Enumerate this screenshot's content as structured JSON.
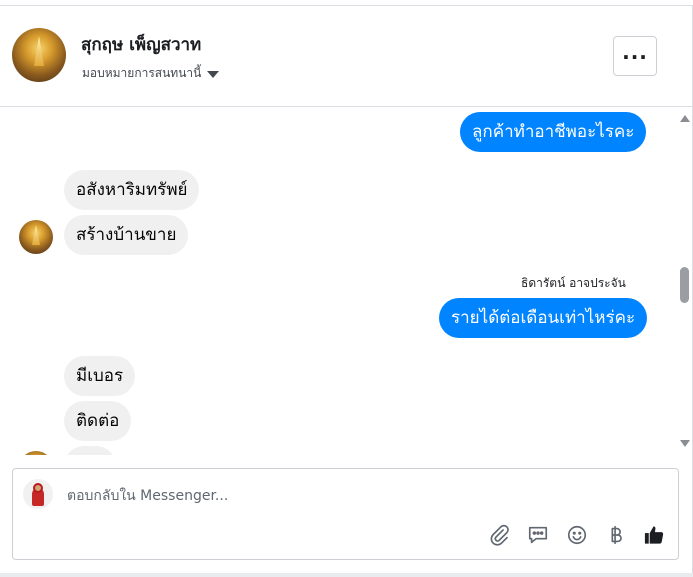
{
  "header": {
    "name": "สุกฤษ เพ็ญสวาท",
    "assign_label": "มอบหมายการสนทนานี้",
    "more_icon": "more-icon"
  },
  "messages": [
    {
      "direction": "out",
      "text": "ลูกค้าทำอาชีพอะไรคะ"
    },
    {
      "direction": "in",
      "text": "อสังหาริมทรัพย์"
    },
    {
      "direction": "in",
      "text": "สร้างบ้านขาย"
    },
    {
      "direction": "out",
      "sender": "ธิดารัตน์ อาจประจัน",
      "text": "รายได้ต่อเดือนเท่าไหร่คะ"
    },
    {
      "direction": "in",
      "text": "มีเบอร"
    },
    {
      "direction": "in",
      "text": "ติดต่อ"
    }
  ],
  "composer": {
    "placeholder": "ตอบกลับใน Messenger...",
    "tools": [
      "paperclip-icon",
      "speech-bubble-icon",
      "smiley-icon",
      "baht-icon",
      "thumbs-up-icon"
    ]
  },
  "colors": {
    "outgoing_bubble": "#0084ff",
    "incoming_bubble": "#f0f0f0",
    "thumbs_up": "#1c1e21"
  }
}
